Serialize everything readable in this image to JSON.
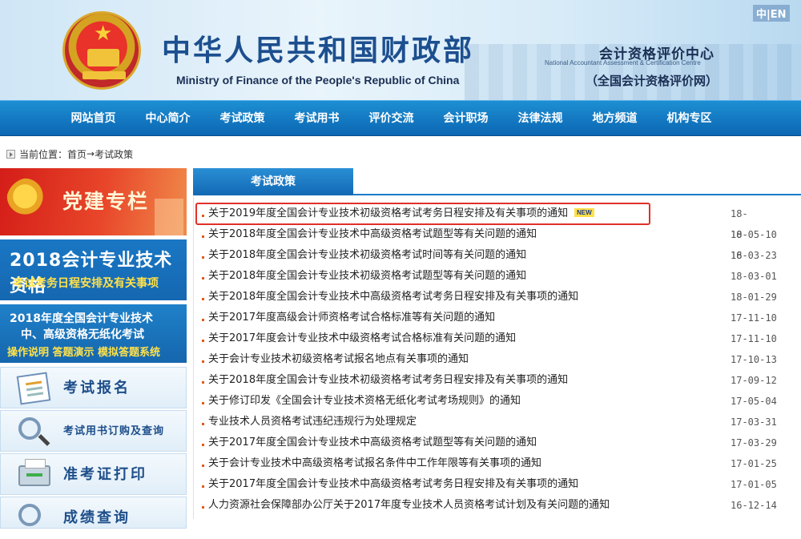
{
  "header": {
    "title_cn": "中华人民共和国财政部",
    "title_en": "Ministry of Finance of the People's Republic of China",
    "center_name_cn": "会计资格评价中心",
    "center_name_en": "National Accountant Assessment & Certification Centre",
    "center_net": "（全国会计资格评价网）",
    "lang_cn": "中",
    "lang_sep": "|",
    "lang_en": "EN"
  },
  "nav": {
    "items": [
      "网站首页",
      "中心简介",
      "考试政策",
      "考试用书",
      "评价交流",
      "会计职场",
      "法律法规",
      "地方频道",
      "机构专区"
    ]
  },
  "breadcrumb": {
    "prefix": "当前位置：",
    "home": "首页",
    "arrow": "→",
    "current": "考试政策"
  },
  "sidebar": {
    "banner_party": "党建专栏",
    "banner_2018_line1": "2018会计专业技术资格",
    "banner_2018_line2": "考试考务日程安排及有关事项",
    "banner_paperless_line1": "2018年度全国会计专业技术",
    "banner_paperless_line2": "中、高级资格无纸化考试",
    "banner_paperless_line3": "操作说明 答题演示 模拟答题系统",
    "quick_register": "考试报名",
    "quick_books": "考试用书订购及查询",
    "quick_ticket": "准考证打印",
    "quick_score": "成绩查询"
  },
  "main": {
    "tab_label": "考试政策",
    "new_badge": "NEW",
    "items": [
      {
        "title": "关于2019年度全国会计专业技术初级资格考试考务日程安排及有关事项的通知",
        "date": "18-10-16"
      },
      {
        "title": "关于2018年度全国会计专业技术中高级资格考试题型等有关问题的通知",
        "date": "18-05-10"
      },
      {
        "title": "关于2018年度全国会计专业技术初级资格考试时间等有关问题的通知",
        "date": "18-03-23"
      },
      {
        "title": "关于2018年度全国会计专业技术初级资格考试题型等有关问题的通知",
        "date": "18-03-01"
      },
      {
        "title": "关于2018年度全国会计专业技术中高级资格考试考务日程安排及有关事项的通知",
        "date": "18-01-29"
      },
      {
        "title": "关于2017年度高级会计师资格考试合格标准等有关问题的通知",
        "date": "17-11-10"
      },
      {
        "title": "关于2017年度会计专业技术中级资格考试合格标准有关问题的通知",
        "date": "17-11-10"
      },
      {
        "title": "关于会计专业技术初级资格考试报名地点有关事项的通知",
        "date": "17-10-13"
      },
      {
        "title": "关于2018年度全国会计专业技术初级资格考试考务日程安排及有关事项的通知",
        "date": "17-09-12"
      },
      {
        "title": "关于修订印发《全国会计专业技术资格无纸化考试考场规则》的通知",
        "date": "17-05-04"
      },
      {
        "title": "专业技术人员资格考试违纪违规行为处理规定",
        "date": "17-03-31"
      },
      {
        "title": "关于2017年度全国会计专业技术中高级资格考试题型等有关问题的通知",
        "date": "17-03-29"
      },
      {
        "title": "关于会计专业技术中高级资格考试报名条件中工作年限等有关事项的通知",
        "date": "17-01-25"
      },
      {
        "title": "关于2017年度全国会计专业技术中高级资格考试考务日程安排及有关事项的通知",
        "date": "17-01-05"
      },
      {
        "title": "人力资源社会保障部办公厅关于2017年度专业技术人员资格考试计划及有关问题的通知",
        "date": "16-12-14"
      }
    ]
  },
  "colors": {
    "nav_blue": "#0c66b3",
    "highlight_red": "#e0302a",
    "title_blue": "#1c4f8f"
  }
}
